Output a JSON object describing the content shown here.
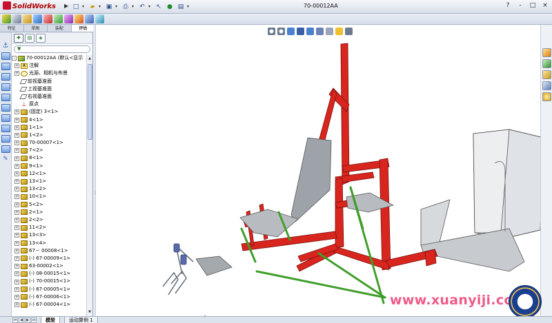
{
  "app": {
    "logo_text": "SolidWorks",
    "document_title": "70-00012AA"
  },
  "window_controls": [
    "?",
    "-",
    "□",
    "×"
  ],
  "manager_tabs": [
    "特征",
    "草图",
    "装配",
    "评估"
  ],
  "bottom_tabs": [
    "模型",
    "运动算例 1"
  ],
  "tree": [
    {
      "label": "70-00012AA  (默认<显示",
      "icon": "assembly-icon",
      "expand": "-"
    },
    {
      "label": "注解",
      "icon": "annotation-icon",
      "expand": "+"
    },
    {
      "label": "光源、相机与布景",
      "icon": "light-icon",
      "expand": "+"
    },
    {
      "label": "前视基准面",
      "icon": "plane-icon",
      "expand": ""
    },
    {
      "label": "上视基准面",
      "icon": "plane-icon",
      "expand": ""
    },
    {
      "label": "右视基准面",
      "icon": "plane-icon",
      "expand": ""
    },
    {
      "label": "原点",
      "icon": "origin-icon",
      "expand": ""
    },
    {
      "label": "(固定) 3<1>",
      "icon": "part-icon",
      "expand": "+"
    },
    {
      "label": "4<1>",
      "icon": "part-icon",
      "expand": "+"
    },
    {
      "label": "1<1>",
      "icon": "part-icon",
      "expand": "+"
    },
    {
      "label": "1<2>",
      "icon": "part-icon",
      "expand": "+"
    },
    {
      "label": "70-00007<1>",
      "icon": "part-icon",
      "expand": "+"
    },
    {
      "label": "7<2>",
      "icon": "part-icon",
      "expand": "+"
    },
    {
      "label": "8<1>",
      "icon": "part-icon",
      "expand": "+"
    },
    {
      "label": "9<1>",
      "icon": "part-icon",
      "expand": "+"
    },
    {
      "label": "12<1>",
      "icon": "part-icon",
      "expand": "+"
    },
    {
      "label": "13<1>",
      "icon": "part-icon",
      "expand": "+"
    },
    {
      "label": "13<2>",
      "icon": "part-icon",
      "expand": "+"
    },
    {
      "label": "10<1>",
      "icon": "part-icon",
      "expand": "+"
    },
    {
      "label": "5<2>",
      "icon": "part-icon",
      "expand": "+"
    },
    {
      "label": "2<1>",
      "icon": "part-icon",
      "expand": "+"
    },
    {
      "label": "2<2>",
      "icon": "part-icon",
      "expand": "+"
    },
    {
      "label": "11<2>",
      "icon": "part-icon",
      "expand": "+"
    },
    {
      "label": "13<3>",
      "icon": "part-icon",
      "expand": "+"
    },
    {
      "label": "13<4>",
      "icon": "part-icon",
      "expand": "+"
    },
    {
      "label": "67－ 00008<1>",
      "icon": "part-icon",
      "expand": "+"
    },
    {
      "label": "(-) 67-00009<1>",
      "icon": "part-icon",
      "expand": "+"
    },
    {
      "label": "63-00002<1>",
      "icon": "part-icon",
      "expand": "+"
    },
    {
      "label": "(-) 08-00015<1>",
      "icon": "part-icon",
      "expand": "+"
    },
    {
      "label": "(-) 70-00015<1>",
      "icon": "part-icon",
      "expand": "+"
    },
    {
      "label": "(-) 67-00005<1>",
      "icon": "part-icon",
      "expand": "+"
    },
    {
      "label": "(-) 67-00006<1>",
      "icon": "part-icon",
      "expand": "+"
    },
    {
      "label": "(-) 67-00004<1>",
      "icon": "part-icon",
      "expand": "+"
    }
  ],
  "watermark": "www.xuanyiji.com",
  "colors": {
    "frame_red": "#d8261e",
    "strut_green": "#3f9e2a",
    "sheet_gray": "#a9adb3",
    "accent_blue": "#3a6bb3"
  }
}
